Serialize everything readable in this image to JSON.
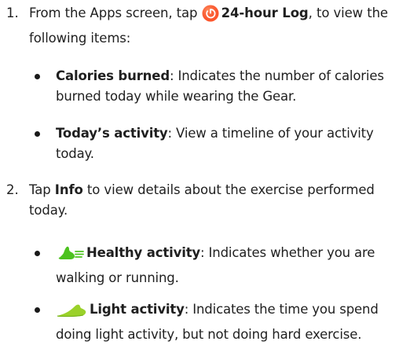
{
  "steps": [
    {
      "number": "1.",
      "prefix": "From the Apps screen, tap ",
      "icon": "24-hour-log-icon",
      "bold": "24-hour Log",
      "suffix": ", to view the following items:",
      "bullets": [
        {
          "bold": "Calories burned",
          "text": ": Indicates the number of calories burned today while wearing the Gear."
        },
        {
          "bold": "Today’s activity",
          "text": ": View a timeline of your activity today."
        }
      ]
    },
    {
      "number": "2.",
      "prefix": "Tap ",
      "bold": "Info",
      "suffix": " to view details about the exercise performed today.",
      "bullets": [
        {
          "icon": "healthy-activity-shoe-icon",
          "bold": "Healthy activity",
          "text": ": Indicates whether you are walking or running."
        },
        {
          "icon": "light-activity-shoe-icon",
          "bold": "Light activity",
          "text": ": Indicates the time you spend doing light activity, but not doing hard exercise."
        }
      ]
    }
  ],
  "colors": {
    "log_icon": "#ff5a2e",
    "healthy_shoe": "#4cc21f",
    "light_shoe": "#9ad12a",
    "text": "#1f1f1f"
  }
}
